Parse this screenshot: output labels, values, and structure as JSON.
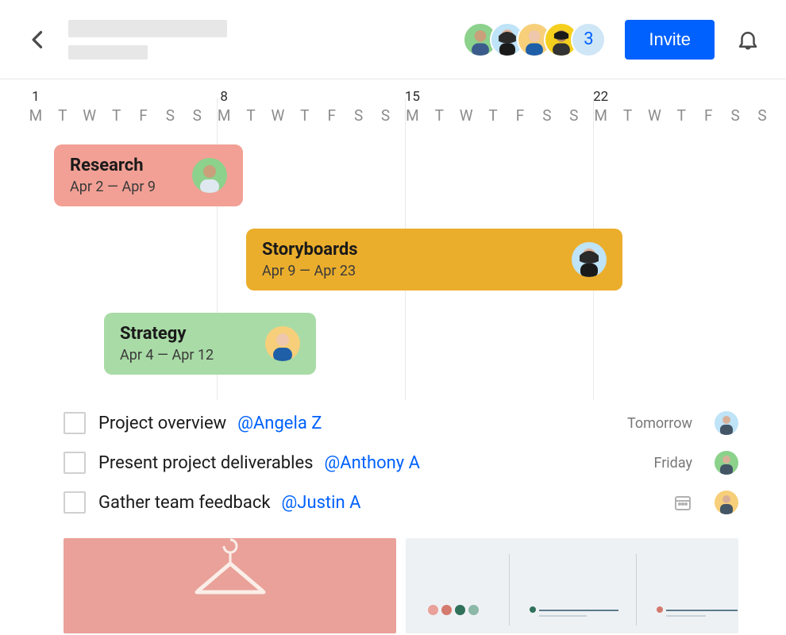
{
  "header": {
    "avatars_extra_count": "3",
    "invite_label": "Invite",
    "avatar_colors": [
      "#8cd18c",
      "#bfe3f7",
      "#f7cf7a",
      "#f5cf1d"
    ]
  },
  "timeline": {
    "week_markers": [
      1,
      8,
      15,
      22
    ],
    "days": [
      {
        "num": "1",
        "letter": "M"
      },
      {
        "num": "",
        "letter": "T"
      },
      {
        "num": "",
        "letter": "W"
      },
      {
        "num": "",
        "letter": "T"
      },
      {
        "num": "",
        "letter": "F"
      },
      {
        "num": "",
        "letter": "S"
      },
      {
        "num": "",
        "letter": "S"
      },
      {
        "num": "8",
        "letter": "M"
      },
      {
        "num": "",
        "letter": "T"
      },
      {
        "num": "",
        "letter": "W"
      },
      {
        "num": "",
        "letter": "T"
      },
      {
        "num": "",
        "letter": "F"
      },
      {
        "num": "",
        "letter": "S"
      },
      {
        "num": "",
        "letter": "S"
      },
      {
        "num": "15",
        "letter": "M"
      },
      {
        "num": "",
        "letter": "T"
      },
      {
        "num": "",
        "letter": "W"
      },
      {
        "num": "",
        "letter": "T"
      },
      {
        "num": "",
        "letter": "F"
      },
      {
        "num": "",
        "letter": "S"
      },
      {
        "num": "",
        "letter": "S"
      },
      {
        "num": "22",
        "letter": "M"
      },
      {
        "num": "",
        "letter": "T"
      },
      {
        "num": "",
        "letter": "W"
      },
      {
        "num": "",
        "letter": "T"
      },
      {
        "num": "",
        "letter": "F"
      },
      {
        "num": "",
        "letter": "S"
      },
      {
        "num": "",
        "letter": "S"
      }
    ],
    "bars": {
      "research": {
        "title": "Research",
        "dates": "Apr 2 — Apr 9",
        "color": "#f2a095",
        "avatar": "#8cd18c"
      },
      "storyboards": {
        "title": "Storyboards",
        "dates": "Apr 9 — Apr 23",
        "color": "#ebae2c",
        "avatar": "#bfe3f7"
      },
      "strategy": {
        "title": "Strategy",
        "dates": "Apr 4 — Apr 12",
        "color": "#a9dba6",
        "avatar": "#f7cf7a"
      }
    }
  },
  "tasks": [
    {
      "title": "Project overview",
      "mention": "@Angela Z",
      "due": "Tomorrow",
      "avatar": "#bfe3f7",
      "has_cal": false
    },
    {
      "title": "Present project deliverables",
      "mention": "@Anthony A",
      "due": "Friday",
      "avatar": "#8cd18c",
      "has_cal": false
    },
    {
      "title": "Gather team feedback",
      "mention": "@Justin A",
      "due": "",
      "avatar": "#f7cf7a",
      "has_cal": true
    }
  ],
  "chart_dots": [
    "#e9a199",
    "#d47a6e",
    "#30715a",
    "#8cb8a8"
  ]
}
